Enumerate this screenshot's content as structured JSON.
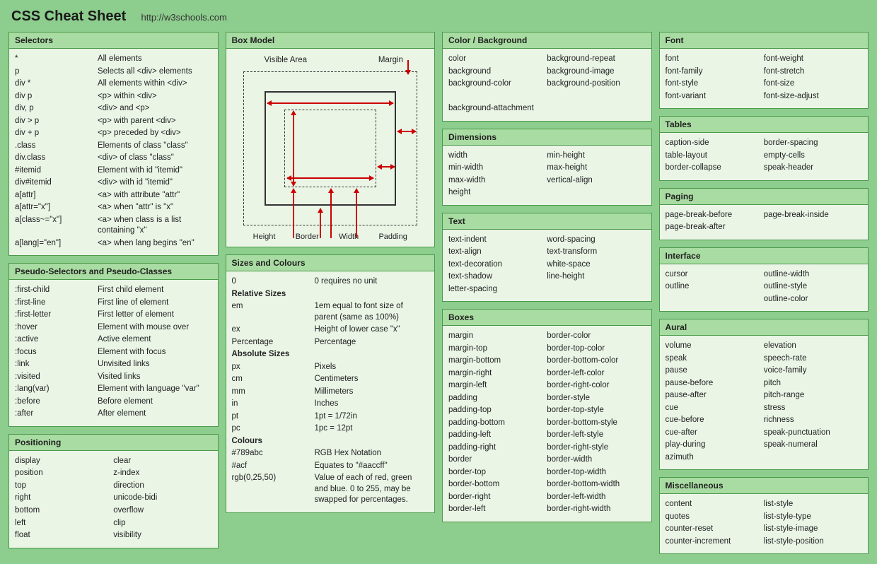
{
  "header": {
    "title": "CSS Cheat Sheet",
    "link": "http://w3schools.com"
  },
  "boxModel": {
    "title": "Box Model",
    "labelsTop": {
      "left": "Visible Area",
      "right": "Margin"
    },
    "labelsBottom": [
      "Height",
      "Border",
      "Width",
      "Padding"
    ]
  },
  "panels": {
    "selectors": {
      "title": "Selectors",
      "rows": [
        [
          "*",
          "All elements"
        ],
        [
          "p",
          "Selects all <div> elements"
        ],
        [
          "div *",
          "All elements within <div>"
        ],
        [
          "div p",
          "<p> within <div>"
        ],
        [
          "div, p",
          "<div> and <p>"
        ],
        [
          "div > p",
          "<p> with parent <div>"
        ],
        [
          "div + p",
          "<p> preceded by <div>"
        ],
        [
          ".class",
          "Elements of class \"class\""
        ],
        [
          "div.class",
          "<div> of class \"class\""
        ],
        [
          "#itemid",
          "Element with id \"itemid\""
        ],
        [
          "div#itemid",
          "<div> with id \"itemid\""
        ],
        [
          "a[attr]",
          "<a> with attribute \"attr\""
        ],
        [
          "a[attr=\"x\"]",
          "<a> when \"attr\" is \"x\""
        ],
        [
          "a[class~=\"x\"]",
          "<a> when class is a list containing \"x\""
        ],
        [
          "a[lang|=\"en\"]",
          "<a> when lang begins \"en\""
        ]
      ]
    },
    "pseudo": {
      "title": "Pseudo-Selectors and Pseudo-Classes",
      "rows": [
        [
          ":first-child",
          "First child element"
        ],
        [
          ":first-line",
          "First line of element"
        ],
        [
          ":first-letter",
          "First letter of element"
        ],
        [
          ":hover",
          "Element with mouse over"
        ],
        [
          ":active",
          "Active element"
        ],
        [
          ":focus",
          "Element with focus"
        ],
        [
          ":link",
          "Unvisited links"
        ],
        [
          ":visited",
          "Visited links"
        ],
        [
          ":lang(var)",
          "Element with language \"var\""
        ],
        [
          ":before",
          "Before element"
        ],
        [
          ":after",
          "After element"
        ]
      ]
    },
    "positioning": {
      "title": "Positioning",
      "left": [
        "display",
        "position",
        "top",
        "right",
        "bottom",
        "left",
        "float"
      ],
      "right": [
        "clear",
        "z-index",
        "direction",
        "unicode-bidi",
        "overflow",
        "clip",
        "visibility"
      ]
    },
    "sizes": {
      "title": "Sizes and Colours",
      "rows": [
        [
          "0",
          "0 requires no unit"
        ],
        [
          "!Relative Sizes",
          ""
        ],
        [
          "em",
          "1em equal to font size of parent (same as 100%)"
        ],
        [
          "ex",
          "Height of lower case \"x\""
        ],
        [
          "Percentage",
          "Percentage"
        ],
        [
          "!Absolute Sizes",
          ""
        ],
        [
          "px",
          "Pixels"
        ],
        [
          "cm",
          "Centimeters"
        ],
        [
          "mm",
          "Millimeters"
        ],
        [
          "in",
          "Inches"
        ],
        [
          "pt",
          "1pt = 1/72in"
        ],
        [
          "pc",
          "1pc = 12pt"
        ],
        [
          "!Colours",
          ""
        ],
        [
          "#789abc",
          "RGB Hex Notation"
        ],
        [
          "#acf",
          "Equates to \"#aaccff\""
        ],
        [
          "rgb(0,25,50)",
          "Value of each of red, green and blue. 0 to 255, may be swapped for percentages."
        ]
      ]
    },
    "colorbg": {
      "title": "Color / Background",
      "left": [
        "color",
        "background",
        "background-color",
        "",
        "background-attachment"
      ],
      "right": [
        "background-repeat",
        "background-image",
        "background-position"
      ]
    },
    "dimensions": {
      "title": "Dimensions",
      "left": [
        "width",
        "min-width",
        "max-width",
        "height"
      ],
      "right": [
        "min-height",
        "max-height",
        "vertical-align"
      ]
    },
    "text": {
      "title": "Text",
      "left": [
        "text-indent",
        "text-align",
        "text-decoration",
        "text-shadow",
        "letter-spacing"
      ],
      "right": [
        "word-spacing",
        "text-transform",
        "white-space",
        "line-height"
      ]
    },
    "boxes": {
      "title": "Boxes",
      "left": [
        "margin",
        "margin-top",
        "margin-bottom",
        "margin-right",
        "margin-left",
        "padding",
        "padding-top",
        "padding-bottom",
        "padding-left",
        "padding-right",
        "border",
        "border-top",
        "border-bottom",
        "border-right",
        "border-left"
      ],
      "right": [
        "border-color",
        "border-top-color",
        "border-bottom-color",
        "border-left-color",
        "border-right-color",
        "border-style",
        "border-top-style",
        "border-bottom-style",
        "border-left-style",
        "border-right-style",
        "border-width",
        "border-top-width",
        "border-bottom-width",
        "border-left-width",
        "border-right-width"
      ]
    },
    "font": {
      "title": "Font",
      "left": [
        "font",
        "font-family",
        "font-style",
        "font-variant"
      ],
      "right": [
        "font-weight",
        "font-stretch",
        "font-size",
        "font-size-adjust"
      ]
    },
    "tables": {
      "title": "Tables",
      "left": [
        "caption-side",
        "table-layout",
        "border-collapse"
      ],
      "right": [
        "border-spacing",
        "empty-cells",
        "speak-header"
      ]
    },
    "paging": {
      "title": "Paging",
      "left": [
        "page-break-before",
        "page-break-after"
      ],
      "right": [
        "page-break-inside"
      ]
    },
    "interface": {
      "title": "Interface",
      "left": [
        "cursor",
        "outline"
      ],
      "right": [
        "outline-width",
        "outline-style",
        "outline-color"
      ]
    },
    "aural": {
      "title": "Aural",
      "left": [
        "volume",
        "speak",
        "pause",
        "pause-before",
        "pause-after",
        "cue",
        "cue-before",
        "cue-after",
        "play-during",
        "azimuth"
      ],
      "right": [
        "elevation",
        "speech-rate",
        "voice-family",
        "pitch",
        "pitch-range",
        "stress",
        "richness",
        "speak-punctuation",
        "speak-numeral"
      ]
    },
    "misc": {
      "title": "Miscellaneous",
      "left": [
        "content",
        "quotes",
        "counter-reset",
        "counter-increment"
      ],
      "right": [
        "list-style",
        "list-style-type",
        "list-style-image",
        "list-style-position"
      ]
    }
  }
}
